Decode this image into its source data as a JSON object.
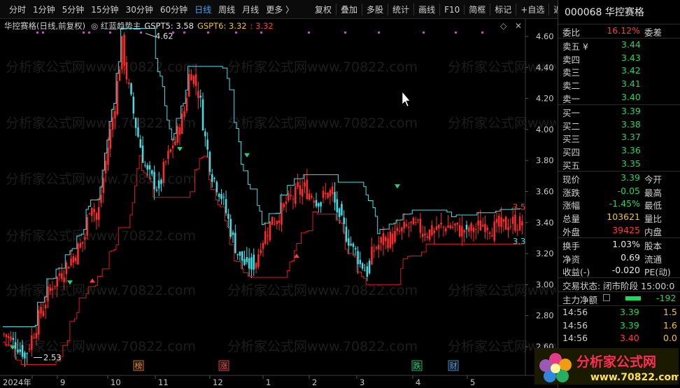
{
  "toolbar": {
    "periods": [
      "分时",
      "1分钟",
      "5分钟",
      "15分钟",
      "30分钟",
      "60分钟",
      "日线",
      "周线",
      "月线",
      "更多 〉"
    ],
    "active_period": "日线",
    "tools": [
      "复权",
      "叠加",
      "多股",
      "统计",
      "画线",
      "F10",
      "简框",
      "标记",
      "+自选",
      "返回"
    ]
  },
  "chart": {
    "title": "华控赛格(日线,前复权)",
    "indicator": "◎ 红蓝趋势主",
    "gspt5": "GSPT5: 3.58",
    "gspt6": "GSPT6: 3.32",
    "gspt7": ": 3.32",
    "high_label": "4.62",
    "low_label": "2.53",
    "right_high": "3.5",
    "right_low": "3.3",
    "y_ticks": [
      "4.60",
      "4.40",
      "4.20",
      "4.00",
      "3.80",
      "3.60",
      "3.40",
      "3.20",
      "3.00",
      "2.80",
      "2.60"
    ],
    "x_ticks": [
      "2024年",
      "9",
      "10",
      "11",
      "12",
      "1",
      "2",
      "3",
      "4",
      "5"
    ],
    "markers": [
      {
        "text": "榜",
        "color": "#e08a3a"
      },
      {
        "text": "涨",
        "color": "#ff4b4b"
      },
      {
        "text": "跌",
        "color": "#26d07c"
      },
      {
        "text": "财",
        "color": "#4aa3ff"
      }
    ],
    "watermark": "分析家公式网www.70822.com"
  },
  "quote": {
    "code_name": "000068 华控赛格",
    "weibi_label": "委比",
    "weibi_value": "16.12%",
    "weicha_label": "委差",
    "asks": [
      {
        "label": "卖五 ¥",
        "price": "3.44"
      },
      {
        "label": "卖四",
        "price": "3.43"
      },
      {
        "label": "卖三",
        "price": "3.42"
      },
      {
        "label": "卖二",
        "price": "3.41"
      },
      {
        "label": "卖一",
        "price": "3.40"
      }
    ],
    "bids": [
      {
        "label": "买一",
        "price": "3.39"
      },
      {
        "label": "买二",
        "price": "3.38"
      },
      {
        "label": "买三",
        "price": "3.37"
      },
      {
        "label": "买四",
        "price": "3.36"
      },
      {
        "label": "买五",
        "price": "3.35"
      }
    ],
    "stats": [
      {
        "l": "现价",
        "v": "3.39",
        "c": "green",
        "r": "今开"
      },
      {
        "l": "涨跌",
        "v": "-0.05",
        "c": "green",
        "r": "最高"
      },
      {
        "l": "涨幅",
        "v": "-1.45%",
        "c": "green",
        "r": "最低"
      },
      {
        "l": "总量",
        "v": "103621",
        "c": "yellow",
        "r": "量比"
      },
      {
        "l": "外盘",
        "v": "39425",
        "c": "red",
        "r": "内盘"
      }
    ],
    "stats2": [
      {
        "l": "换手",
        "v": "1.03%",
        "c": "white",
        "r": "股本"
      },
      {
        "l": "净资",
        "v": "0.69",
        "c": "white",
        "r": "流通"
      },
      {
        "l": "收益(-)",
        "v": "-0.020",
        "c": "white",
        "r": "PE(动)"
      }
    ],
    "trade_status": "交易状态: 闭市阶段 15:00:0",
    "main_flow_label": "主力净额",
    "main_flow_value": "-192",
    "ticks": [
      {
        "time": "14:56",
        "price": "3.39",
        "pc": "green",
        "vol": "1.5"
      },
      {
        "time": "14:56",
        "price": "3.39",
        "pc": "green",
        "vol": "1.6"
      },
      {
        "time": "14:56",
        "price": "3.40",
        "pc": "red",
        "vol": "0.0"
      }
    ]
  },
  "badge": {
    "text": "分析家公式网",
    "url": "www.70822.com"
  }
}
